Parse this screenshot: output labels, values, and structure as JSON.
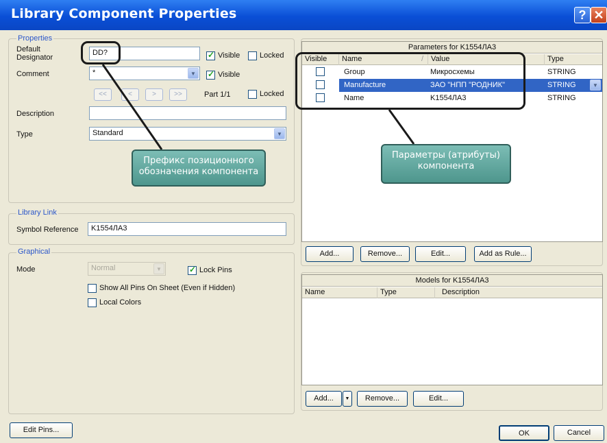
{
  "window": {
    "title": "Library Component Properties",
    "help_glyph": "?",
    "close_glyph": "✕"
  },
  "properties": {
    "group_label": "Properties",
    "designator_label": "Default Designator",
    "designator_value": "DD?",
    "visible_label": "Visible",
    "locked_label": "Locked",
    "comment_label": "Comment",
    "comment_value": "*",
    "nav_buttons": [
      "<<",
      "<",
      ">",
      ">>"
    ],
    "part_label": "Part 1/1",
    "description_label": "Description",
    "description_value": "",
    "type_label": "Type",
    "type_value": "Standard",
    "designator_visible": true,
    "designator_locked": false,
    "comment_visible": true,
    "part_locked": false
  },
  "library_link": {
    "group_label": "Library Link",
    "symbol_reference_label": "Symbol Reference",
    "symbol_reference_value": "K1554ЛА3"
  },
  "graphical": {
    "group_label": "Graphical",
    "mode_label": "Mode",
    "mode_value": "Normal",
    "lock_pins_label": "Lock Pins",
    "show_all_pins_label": "Show All Pins On Sheet (Even if Hidden)",
    "local_colors_label": "Local Colors",
    "lock_pins": true,
    "show_all_pins": false,
    "local_colors": false
  },
  "parameters": {
    "caption": "Parameters for K1554ЛА3",
    "columns": [
      "Visible",
      "Name",
      "Value",
      "Type"
    ],
    "sort_glyph": "/",
    "rows": [
      {
        "visible": false,
        "name": "Group",
        "value": "Микросхемы",
        "type": "STRING"
      },
      {
        "visible": false,
        "name": "Manufacture",
        "value": "ЗАО \"НПП \"РОДНИК\"",
        "type": "STRING",
        "selected": true
      },
      {
        "visible": false,
        "name": "Name",
        "value": "K1554ЛА3",
        "type": "STRING"
      }
    ],
    "buttons": [
      "Add...",
      "Remove...",
      "Edit...",
      "Add as Rule..."
    ]
  },
  "models": {
    "caption": "Models for K1554ЛА3",
    "columns": [
      "Name",
      "Type",
      "Description"
    ],
    "buttons": [
      "Add...",
      "Remove...",
      "Edit..."
    ],
    "add_dropdown_glyph": "▼"
  },
  "footer": {
    "edit_pins": "Edit Pins...",
    "ok": "OK",
    "cancel": "Cancel"
  },
  "callouts": {
    "prefix_note": "Префикс позиционного обозначения компонента",
    "params_note": "Параметры (атрибуты) компонента"
  },
  "colors": {
    "title_bar": "#0a4fd6",
    "selection": "#3165c5",
    "callout": "#5ea69d"
  }
}
